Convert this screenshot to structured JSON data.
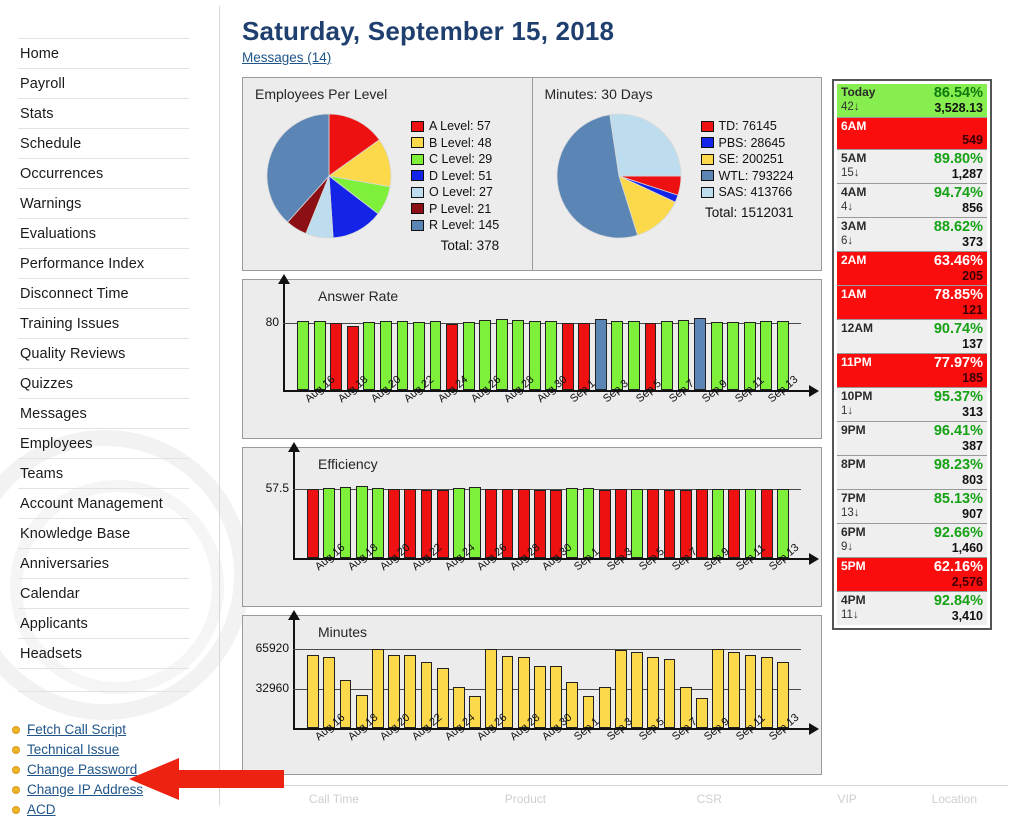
{
  "sidebar": {
    "items": [
      {
        "label": "Home"
      },
      {
        "label": "Payroll"
      },
      {
        "label": "Stats"
      },
      {
        "label": "Schedule"
      },
      {
        "label": "Occurrences"
      },
      {
        "label": "Warnings"
      },
      {
        "label": "Evaluations"
      },
      {
        "label": "Performance Index"
      },
      {
        "label": "Disconnect Time"
      },
      {
        "label": "Training Issues"
      },
      {
        "label": "Quality Reviews"
      },
      {
        "label": "Quizzes"
      },
      {
        "label": "Messages"
      },
      {
        "label": "Employees"
      },
      {
        "label": "Teams"
      },
      {
        "label": "Account Management"
      },
      {
        "label": "Knowledge Base"
      },
      {
        "label": "Anniversaries"
      },
      {
        "label": "Calendar"
      },
      {
        "label": "Applicants"
      },
      {
        "label": "Headsets"
      }
    ],
    "quick_links": [
      {
        "label": "Fetch Call Script"
      },
      {
        "label": "Technical Issue"
      },
      {
        "label": "Change Password"
      },
      {
        "label": "Change IP Address"
      },
      {
        "label": "ACD"
      }
    ],
    "annotation": {
      "name": "red-pointer-arrow",
      "points_to": "ACD",
      "color": "#ee2211"
    }
  },
  "header": {
    "title": "Saturday, September 15, 2018",
    "messages_link": "Messages (14)"
  },
  "colors": {
    "green_bar": "#7ef03a",
    "red_bar": "#ee1111",
    "blue_bar": "#5b85b5",
    "yellow_bar": "#fcd94b",
    "title_blue": "#1f3f6e",
    "link_blue": "#20558a",
    "alert_red": "#fb0d0d",
    "ok_green": "#15a215",
    "today_green": "#86ee4e"
  },
  "chart_data": [
    {
      "type": "pie",
      "title": "Employees Per Level",
      "total_label": "Total: 378",
      "total": 378,
      "slices": [
        {
          "name": "A Level",
          "value": 57,
          "color": "#ee1111",
          "legend": "A Level: 57"
        },
        {
          "name": "B Level",
          "value": 48,
          "color": "#fcd94b",
          "legend": "B Level: 48"
        },
        {
          "name": "C Level",
          "value": 29,
          "color": "#7ef03a",
          "legend": "C Level: 29"
        },
        {
          "name": "D Level",
          "value": 51,
          "color": "#1423e8",
          "legend": "D Level: 51"
        },
        {
          "name": "O Level",
          "value": 27,
          "color": "#bdddee",
          "legend": "O Level: 27"
        },
        {
          "name": "P Level",
          "value": 21,
          "color": "#8b0f14",
          "legend": "P Level: 21"
        },
        {
          "name": "R Level",
          "value": 145,
          "color": "#5b85b5",
          "legend": "R Level: 145"
        }
      ]
    },
    {
      "type": "pie",
      "title": "Minutes: 30 Days",
      "total_label": "Total: 1512031",
      "total": 1512031,
      "slices": [
        {
          "name": "TD",
          "value": 76145,
          "color": "#ee1111",
          "legend": "TD: 76145"
        },
        {
          "name": "PBS",
          "value": 28645,
          "color": "#1423e8",
          "legend": "PBS: 28645"
        },
        {
          "name": "SE",
          "value": 200251,
          "color": "#fcd94b",
          "legend": "SE: 200251"
        },
        {
          "name": "WTL",
          "value": 793224,
          "color": "#5b85b5",
          "legend": "WTL: 793224"
        },
        {
          "name": "SAS",
          "value": 413766,
          "color": "#bdddee",
          "legend": "SAS: 413766"
        }
      ]
    },
    {
      "type": "bar",
      "title": "Answer Rate",
      "ylabel": "",
      "xlabel": "",
      "yticks": [
        "80"
      ],
      "ytick_values": [
        80
      ],
      "ylim": [
        0,
        100
      ],
      "grid": true,
      "categories": [
        "Aug 16",
        "Aug 17",
        "Aug 18",
        "Aug 19",
        "Aug 20",
        "Aug 21",
        "Aug 22",
        "Aug 23",
        "Aug 24",
        "Aug 25",
        "Aug 26",
        "Aug 27",
        "Aug 28",
        "Aug 29",
        "Aug 30",
        "Aug 31",
        "Sep 1",
        "Sep 2",
        "Sep 3",
        "Sep 4",
        "Sep 5",
        "Sep 6",
        "Sep 7",
        "Sep 8",
        "Sep 9",
        "Sep 10",
        "Sep 11",
        "Sep 12",
        "Sep 13",
        "Sep 14"
      ],
      "tick_labels": [
        "Aug 16",
        "Aug 18",
        "Aug 20",
        "Aug 22",
        "Aug 24",
        "Aug 26",
        "Aug 28",
        "Aug 30",
        "Sep 1",
        "Sep 3",
        "Sep 5",
        "Sep 7",
        "Sep 9",
        "Sep 11",
        "Sep 13"
      ],
      "values": [
        82,
        82,
        80,
        76,
        81,
        82,
        82,
        81,
        82,
        78,
        81,
        83,
        84,
        83,
        82,
        82,
        80,
        80,
        85,
        82,
        82,
        80,
        82,
        83,
        86,
        81,
        81,
        81,
        82,
        82
      ],
      "bar_colors": [
        "green",
        "green",
        "red",
        "red",
        "green",
        "green",
        "green",
        "green",
        "green",
        "red",
        "green",
        "green",
        "green",
        "green",
        "green",
        "green",
        "red",
        "red",
        "blue",
        "green",
        "green",
        "red",
        "green",
        "green",
        "blue",
        "green",
        "green",
        "green",
        "green",
        "green"
      ]
    },
    {
      "type": "bar",
      "title": "Efficiency",
      "ylabel": "",
      "xlabel": "",
      "yticks": [
        "57.5"
      ],
      "ytick_values": [
        57.5
      ],
      "ylim": [
        0,
        70
      ],
      "grid": true,
      "categories": [
        "Aug 16",
        "Aug 17",
        "Aug 18",
        "Aug 19",
        "Aug 20",
        "Aug 21",
        "Aug 22",
        "Aug 23",
        "Aug 24",
        "Aug 25",
        "Aug 26",
        "Aug 27",
        "Aug 28",
        "Aug 29",
        "Aug 30",
        "Aug 31",
        "Sep 1",
        "Sep 2",
        "Sep 3",
        "Sep 4",
        "Sep 5",
        "Sep 6",
        "Sep 7",
        "Sep 8",
        "Sep 9",
        "Sep 10",
        "Sep 11",
        "Sep 12",
        "Sep 13",
        "Sep 14"
      ],
      "tick_labels": [
        "Aug 16",
        "Aug 18",
        "Aug 20",
        "Aug 22",
        "Aug 24",
        "Aug 26",
        "Aug 28",
        "Aug 30",
        "Sep 1",
        "Sep 3",
        "Sep 5",
        "Sep 7",
        "Sep 9",
        "Sep 11",
        "Sep 13"
      ],
      "values": [
        57.5,
        58.2,
        59.5,
        60.2,
        58.3,
        57.2,
        57.4,
        56.9,
        57.0,
        58.4,
        58.8,
        57.4,
        57.2,
        57.4,
        56.6,
        56.9,
        58.6,
        58.5,
        57.0,
        57.4,
        57.7,
        57.4,
        57.0,
        57.0,
        57.4,
        57.7,
        57.5,
        57.7,
        57.4,
        57.7
      ],
      "bar_colors": [
        "red",
        "green",
        "green",
        "green",
        "green",
        "red",
        "red",
        "red",
        "red",
        "green",
        "green",
        "red",
        "red",
        "red",
        "red",
        "red",
        "green",
        "green",
        "red",
        "red",
        "green",
        "red",
        "red",
        "red",
        "red",
        "green",
        "red",
        "green",
        "red",
        "green"
      ]
    },
    {
      "type": "bar",
      "title": "Minutes",
      "ylabel": "",
      "xlabel": "",
      "yticks": [
        "65920",
        "32960"
      ],
      "ytick_values": [
        65920,
        32960
      ],
      "ylim": [
        0,
        72000
      ],
      "grid": true,
      "categories": [
        "Aug 16",
        "Aug 17",
        "Aug 18",
        "Aug 19",
        "Aug 20",
        "Aug 21",
        "Aug 22",
        "Aug 23",
        "Aug 24",
        "Aug 25",
        "Aug 26",
        "Aug 27",
        "Aug 28",
        "Aug 29",
        "Aug 30",
        "Aug 31",
        "Sep 1",
        "Sep 2",
        "Sep 3",
        "Sep 4",
        "Sep 5",
        "Sep 6",
        "Sep 7",
        "Sep 8",
        "Sep 9",
        "Sep 10",
        "Sep 11",
        "Sep 12",
        "Sep 13",
        "Sep 14"
      ],
      "tick_labels": [
        "Aug 16",
        "Aug 18",
        "Aug 20",
        "Aug 22",
        "Aug 24",
        "Aug 26",
        "Aug 28",
        "Aug 30",
        "Sep 1",
        "Sep 3",
        "Sep 5",
        "Sep 7",
        "Sep 9",
        "Sep 11",
        "Sep 13"
      ],
      "values": [
        61500,
        59800,
        40500,
        27500,
        65900,
        61000,
        61500,
        55500,
        50000,
        34500,
        27000,
        65900,
        60500,
        59500,
        52000,
        52000,
        38500,
        26500,
        34000,
        65200,
        63800,
        59800,
        57500,
        34000,
        25500,
        65920,
        63500,
        61000,
        59800,
        55500
      ],
      "bar_color": "yellow"
    }
  ],
  "hourly_panel": {
    "rows": [
      {
        "hour": "Today",
        "pct": "86.54%",
        "delta": "42↓",
        "count": "3,528.13",
        "state": "today"
      },
      {
        "hour": "6AM",
        "pct": "",
        "delta": "",
        "count": "549",
        "state": "bad"
      },
      {
        "hour": "5AM",
        "pct": "89.80%",
        "delta": "15↓",
        "count": "1,287",
        "state": "ok"
      },
      {
        "hour": "4AM",
        "pct": "94.74%",
        "delta": "4↓",
        "count": "856",
        "state": "ok"
      },
      {
        "hour": "3AM",
        "pct": "88.62%",
        "delta": "6↓",
        "count": "373",
        "state": "ok"
      },
      {
        "hour": "2AM",
        "pct": "63.46%",
        "delta": "",
        "count": "205",
        "state": "bad"
      },
      {
        "hour": "1AM",
        "pct": "78.85%",
        "delta": "",
        "count": "121",
        "state": "bad"
      },
      {
        "hour": "12AM",
        "pct": "90.74%",
        "delta": "",
        "count": "137",
        "state": "ok"
      },
      {
        "hour": "11PM",
        "pct": "77.97%",
        "delta": "",
        "count": "185",
        "state": "bad"
      },
      {
        "hour": "10PM",
        "pct": "95.37%",
        "delta": "1↓",
        "count": "313",
        "state": "ok"
      },
      {
        "hour": "9PM",
        "pct": "96.41%",
        "delta": "",
        "count": "387",
        "state": "ok"
      },
      {
        "hour": "8PM",
        "pct": "98.23%",
        "delta": "",
        "count": "803",
        "state": "ok"
      },
      {
        "hour": "7PM",
        "pct": "85.13%",
        "delta": "13↓",
        "count": "907",
        "state": "ok"
      },
      {
        "hour": "6PM",
        "pct": "92.66%",
        "delta": "9↓",
        "count": "1,460",
        "state": "ok"
      },
      {
        "hour": "5PM",
        "pct": "62.16%",
        "delta": "",
        "count": "2,576",
        "state": "bad"
      },
      {
        "hour": "4PM",
        "pct": "92.84%",
        "delta": "11↓",
        "count": "3,410",
        "state": "ok"
      }
    ]
  },
  "bottom_table": {
    "headers": [
      "Call Time",
      "Product",
      "CSR",
      "VIP",
      "Location"
    ]
  }
}
